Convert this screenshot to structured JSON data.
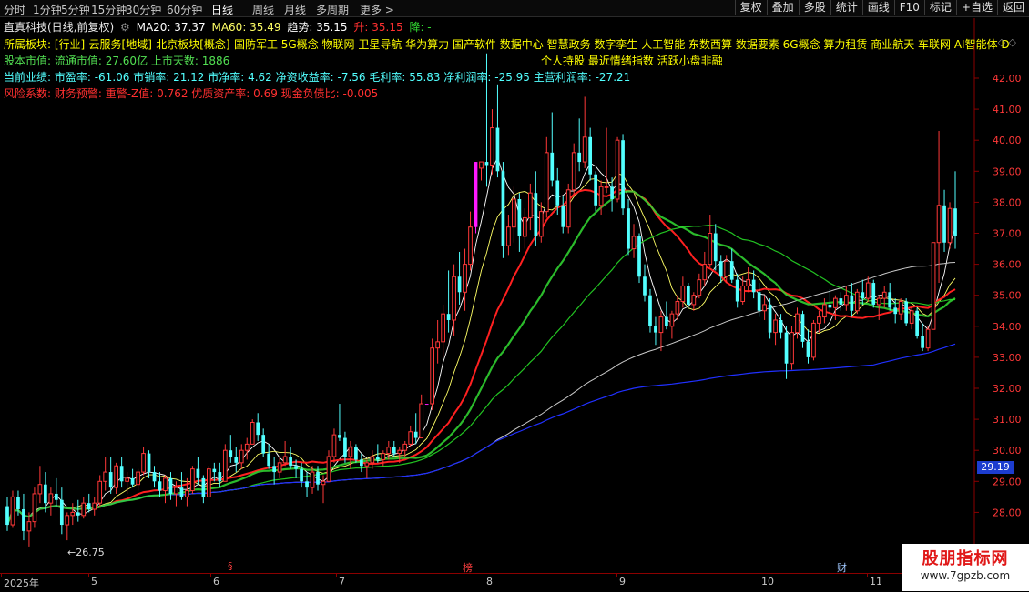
{
  "toolbar": {
    "periods": [
      "分时",
      "1分钟",
      "5分钟",
      "15分钟",
      "30分钟",
      "60分钟",
      "日线",
      "周线",
      "月线",
      "多周期",
      "更多 >"
    ],
    "active_period": "日线",
    "right_buttons": [
      "复权",
      "叠加",
      "多股",
      "统计",
      "画线",
      "F10",
      "标记",
      "+自选",
      "返回"
    ]
  },
  "info": {
    "stock": "直真科技(日线,前复权)",
    "ma20": "MA20: 37.37",
    "ma60": "MA60: 35.49",
    "trend": "趋势: 35.15",
    "up": "升: 35.15",
    "down": "降: -"
  },
  "panels": {
    "sectors": "所属板块: [行业]-云服务[地域]-北京板块[概念]-国防军工 5G概念 物联网 卫星导航 华为算力 国产软件 数据中心 智慧政务 数字孪生 人工智能 东数西算 数据要素 6G概念 算力租赁 商业航天 车联网 AI智能体 D",
    "sectors_line2": "个人持股 最近情绪指数 活跃小盘非融",
    "capital": "股本市值: 流通市值: 27.60亿 上市天数: 1886",
    "performance": "当前业绩: 市盈率: -61.06 市销率: 21.12 市净率: 4.62 净资收益率: -7.56 毛利率: 55.83 净利润率: -25.95 主营利润率: -27.21",
    "risk": "风险系数: 财务预警: 重警-Z值: 0.762 优质资产率: 0.69 现金负债比: -0.005"
  },
  "colors": {
    "up": "#ff3838",
    "down": "#52ffff",
    "limit_up": "#ff1aff",
    "ma_short": "#ffffff",
    "ma_yellow": "#ffff66",
    "ma_red": "#ff2020",
    "ma_green": "#22c322",
    "ma_gray": "#c8c8c8",
    "ma_blue": "#2030ff",
    "trend_green": "#32dc32"
  },
  "price_tag": "29.19",
  "low_label": "26.75",
  "watermark": {
    "title": "股朋指标网",
    "url": "www.7gpzb.com"
  },
  "x_axis_labels": [
    "2025年",
    "5",
    "6",
    "7",
    "8",
    "9",
    "10",
    "11"
  ],
  "markers": [
    {
      "text": "§",
      "color": "#ff4040"
    },
    {
      "text": "榜",
      "color": "#ff4040"
    },
    {
      "text": "财",
      "color": "#a0c8ff"
    }
  ],
  "chart_data": {
    "type": "candlestick",
    "title": "直真科技(日线,前复权)",
    "y_ticks": [
      28.0,
      29.0,
      30.0,
      31.0,
      32.0,
      33.0,
      34.0,
      35.0,
      36.0,
      37.0,
      38.0,
      39.0,
      40.0,
      41.0,
      42.0
    ],
    "ylim": [
      26.5,
      42.8
    ],
    "x_months": [
      "2025年",
      "5",
      "6",
      "7",
      "8",
      "9",
      "10",
      "11"
    ],
    "candles": [
      [
        28.2,
        28.5,
        27.4,
        27.6
      ],
      [
        27.6,
        28.7,
        27.5,
        28.5
      ],
      [
        28.5,
        28.7,
        27.9,
        28.1
      ],
      [
        28.1,
        28.6,
        27.1,
        27.4
      ],
      [
        27.4,
        28.0,
        26.9,
        27.7
      ],
      [
        27.7,
        28.8,
        27.5,
        28.6
      ],
      [
        28.6,
        29.5,
        28.3,
        28.9
      ],
      [
        28.9,
        29.3,
        28.0,
        28.3
      ],
      [
        28.3,
        28.8,
        27.9,
        28.6
      ],
      [
        28.6,
        29.1,
        28.2,
        28.4
      ],
      [
        28.4,
        28.8,
        27.3,
        27.6
      ],
      [
        27.6,
        28.0,
        27.1,
        27.9
      ],
      [
        27.9,
        28.3,
        27.6,
        28.0
      ],
      [
        28.0,
        28.4,
        27.7,
        27.9
      ],
      [
        27.9,
        28.5,
        27.8,
        28.3
      ],
      [
        28.3,
        28.6,
        28.0,
        28.1
      ],
      [
        28.1,
        28.5,
        27.9,
        28.3
      ],
      [
        28.3,
        29.2,
        28.2,
        29.0
      ],
      [
        29.0,
        29.8,
        28.7,
        29.3
      ],
      [
        29.3,
        29.8,
        28.6,
        28.8
      ],
      [
        28.8,
        29.6,
        28.6,
        29.5
      ],
      [
        29.5,
        29.8,
        28.8,
        29.0
      ],
      [
        29.0,
        29.3,
        28.6,
        29.1
      ],
      [
        29.1,
        29.4,
        28.8,
        28.9
      ],
      [
        28.9,
        29.4,
        28.7,
        29.3
      ],
      [
        29.3,
        30.1,
        29.2,
        29.9
      ],
      [
        29.9,
        30.0,
        29.1,
        29.3
      ],
      [
        29.3,
        29.5,
        28.8,
        29.0
      ],
      [
        29.0,
        29.3,
        28.5,
        28.7
      ],
      [
        28.7,
        29.2,
        28.3,
        29.1
      ],
      [
        29.1,
        29.3,
        28.4,
        28.6
      ],
      [
        28.6,
        29.0,
        28.2,
        28.8
      ],
      [
        28.8,
        29.3,
        28.4,
        28.5
      ],
      [
        28.5,
        29.1,
        28.2,
        28.7
      ],
      [
        28.7,
        29.5,
        28.6,
        29.4
      ],
      [
        29.4,
        29.8,
        28.9,
        29.1
      ],
      [
        29.1,
        29.2,
        28.3,
        28.5
      ],
      [
        28.5,
        29.5,
        28.5,
        29.4
      ],
      [
        29.4,
        29.6,
        29.0,
        29.3
      ],
      [
        29.3,
        29.6,
        28.8,
        29.0
      ],
      [
        29.0,
        30.2,
        29.0,
        30.0
      ],
      [
        30.0,
        30.5,
        29.6,
        29.8
      ],
      [
        29.8,
        30.1,
        29.3,
        29.6
      ],
      [
        29.6,
        30.2,
        29.4,
        30.0
      ],
      [
        30.0,
        30.4,
        29.7,
        30.2
      ],
      [
        30.2,
        31.0,
        30.2,
        30.9
      ],
      [
        30.9,
        31.2,
        30.3,
        30.5
      ],
      [
        30.5,
        30.7,
        29.8,
        29.9
      ],
      [
        29.9,
        30.2,
        29.4,
        29.5
      ],
      [
        29.5,
        29.8,
        28.9,
        29.3
      ],
      [
        29.3,
        29.8,
        29.1,
        29.6
      ],
      [
        29.6,
        30.3,
        29.5,
        29.8
      ],
      [
        29.8,
        30.1,
        29.4,
        29.5
      ],
      [
        29.5,
        29.7,
        29.1,
        29.4
      ],
      [
        29.4,
        29.6,
        28.8,
        29.0
      ],
      [
        29.0,
        29.3,
        28.5,
        28.8
      ],
      [
        28.8,
        29.5,
        28.6,
        29.3
      ],
      [
        29.3,
        29.5,
        28.7,
        28.9
      ],
      [
        28.9,
        29.2,
        28.3,
        29.0
      ],
      [
        29.0,
        30.0,
        29.0,
        29.8
      ],
      [
        29.8,
        30.7,
        29.6,
        30.5
      ],
      [
        30.5,
        31.5,
        30.3,
        30.4
      ],
      [
        30.4,
        30.6,
        29.6,
        29.8
      ],
      [
        29.8,
        30.3,
        29.4,
        30.1
      ],
      [
        30.1,
        30.2,
        29.6,
        29.7
      ],
      [
        29.7,
        29.9,
        29.3,
        29.5
      ],
      [
        29.5,
        29.7,
        29.1,
        29.6
      ],
      [
        29.6,
        30.0,
        29.4,
        29.8
      ],
      [
        29.8,
        30.2,
        29.6,
        29.7
      ],
      [
        29.7,
        30.0,
        29.5,
        29.9
      ],
      [
        29.9,
        30.3,
        29.7,
        30.1
      ],
      [
        30.1,
        30.3,
        29.8,
        29.9
      ],
      [
        29.9,
        30.1,
        29.6,
        30.0
      ],
      [
        30.0,
        30.3,
        29.8,
        30.2
      ],
      [
        30.2,
        30.8,
        30.1,
        30.6
      ],
      [
        30.6,
        31.2,
        30.2,
        30.4
      ],
      [
        30.4,
        31.8,
        30.4,
        31.5
      ],
      [
        31.5,
        31.5,
        31.5,
        31.5
      ],
      [
        31.5,
        33.6,
        31.3,
        33.3
      ],
      [
        33.3,
        34.2,
        32.8,
        33.5
      ],
      [
        33.5,
        34.7,
        33.0,
        34.4
      ],
      [
        34.4,
        35.8,
        33.8,
        34.2
      ],
      [
        34.2,
        36.0,
        33.7,
        35.6
      ],
      [
        35.6,
        36.4,
        34.7,
        35.1
      ],
      [
        35.1,
        36.5,
        34.5,
        36.0
      ],
      [
        36.0,
        37.7,
        35.8,
        37.2
      ],
      [
        37.2,
        39.3,
        37.0,
        39.3
      ],
      [
        39.1,
        39.3,
        38.7,
        39.3
      ],
      [
        39.3,
        42.8,
        38.5,
        39.2
      ],
      [
        39.2,
        41.0,
        38.9,
        40.4
      ],
      [
        40.4,
        41.8,
        38.8,
        39.0
      ],
      [
        39.0,
        39.3,
        36.2,
        36.6
      ],
      [
        36.6,
        37.6,
        36.3,
        37.2
      ],
      [
        37.2,
        38.5,
        36.7,
        38.1
      ],
      [
        38.1,
        38.3,
        36.4,
        36.9
      ],
      [
        36.9,
        37.8,
        36.5,
        37.5
      ],
      [
        37.5,
        38.6,
        37.1,
        38.3
      ],
      [
        38.3,
        39.0,
        36.6,
        36.9
      ],
      [
        36.9,
        38.0,
        36.7,
        37.7
      ],
      [
        37.7,
        40.1,
        37.5,
        39.6
      ],
      [
        39.6,
        40.9,
        38.5,
        38.7
      ],
      [
        38.7,
        39.1,
        37.6,
        37.9
      ],
      [
        37.9,
        38.2,
        37.0,
        37.2
      ],
      [
        37.2,
        38.6,
        37.0,
        38.4
      ],
      [
        38.4,
        39.9,
        38.2,
        39.6
      ],
      [
        39.6,
        40.7,
        39.0,
        39.3
      ],
      [
        39.3,
        41.4,
        39.1,
        40.1
      ],
      [
        40.1,
        40.4,
        38.7,
        38.9
      ],
      [
        38.9,
        39.0,
        37.7,
        37.9
      ],
      [
        37.9,
        38.7,
        37.6,
        38.5
      ],
      [
        38.5,
        40.4,
        38.3,
        38.5
      ],
      [
        38.5,
        38.8,
        37.7,
        38.1
      ],
      [
        38.1,
        40.1,
        38.0,
        40.0
      ],
      [
        40.0,
        40.2,
        37.6,
        37.8
      ],
      [
        37.8,
        38.1,
        36.3,
        36.5
      ],
      [
        36.5,
        37.3,
        36.2,
        36.9
      ],
      [
        36.9,
        37.0,
        35.4,
        35.6
      ],
      [
        35.6,
        36.0,
        34.8,
        35.0
      ],
      [
        35.0,
        35.2,
        33.8,
        34.0
      ],
      [
        34.0,
        34.3,
        33.4,
        33.8
      ],
      [
        33.8,
        34.5,
        33.2,
        34.3
      ],
      [
        34.3,
        34.8,
        33.9,
        34.0
      ],
      [
        34.0,
        34.5,
        33.6,
        34.4
      ],
      [
        34.4,
        35.0,
        34.2,
        34.8
      ],
      [
        34.8,
        35.6,
        34.6,
        35.3
      ],
      [
        35.3,
        35.4,
        34.6,
        34.7
      ],
      [
        34.7,
        35.1,
        34.5,
        35.0
      ],
      [
        35.0,
        35.7,
        34.9,
        35.5
      ],
      [
        35.5,
        36.4,
        35.3,
        36.0
      ],
      [
        36.0,
        37.6,
        35.9,
        37.0
      ],
      [
        37.0,
        37.3,
        35.8,
        36.1
      ],
      [
        36.1,
        36.3,
        35.4,
        35.6
      ],
      [
        35.6,
        36.3,
        35.4,
        36.1
      ],
      [
        36.1,
        36.5,
        35.4,
        35.5
      ],
      [
        35.5,
        35.7,
        34.6,
        34.8
      ],
      [
        34.8,
        35.6,
        34.7,
        35.3
      ],
      [
        35.3,
        35.9,
        35.1,
        35.5
      ],
      [
        35.5,
        35.8,
        34.9,
        35.1
      ],
      [
        35.1,
        35.4,
        34.3,
        34.5
      ],
      [
        34.5,
        35.0,
        34.2,
        34.7
      ],
      [
        34.7,
        34.9,
        33.6,
        33.8
      ],
      [
        33.8,
        34.4,
        33.4,
        34.2
      ],
      [
        34.2,
        34.4,
        33.6,
        33.8
      ],
      [
        33.8,
        34.0,
        32.3,
        32.8
      ],
      [
        32.8,
        34.0,
        32.6,
        33.8
      ],
      [
        33.8,
        34.6,
        33.6,
        34.4
      ],
      [
        34.4,
        34.5,
        33.3,
        33.5
      ],
      [
        33.5,
        33.9,
        32.8,
        33.0
      ],
      [
        33.0,
        34.2,
        32.9,
        34.1
      ],
      [
        34.1,
        34.5,
        33.8,
        34.3
      ],
      [
        34.3,
        34.9,
        34.1,
        34.7
      ],
      [
        34.7,
        35.2,
        34.4,
        34.6
      ],
      [
        34.6,
        35.0,
        34.2,
        34.9
      ],
      [
        34.9,
        35.1,
        34.5,
        34.7
      ],
      [
        34.7,
        35.3,
        34.5,
        35.0
      ],
      [
        35.0,
        35.4,
        34.3,
        34.5
      ],
      [
        34.5,
        35.2,
        34.4,
        35.1
      ],
      [
        35.1,
        35.5,
        34.7,
        34.9
      ],
      [
        34.9,
        35.6,
        34.8,
        35.4
      ],
      [
        35.4,
        35.5,
        34.6,
        34.7
      ],
      [
        34.7,
        35.0,
        34.2,
        34.9
      ],
      [
        34.9,
        35.3,
        34.6,
        35.1
      ],
      [
        35.1,
        35.4,
        34.5,
        34.6
      ],
      [
        34.6,
        34.9,
        34.1,
        34.4
      ],
      [
        34.4,
        34.9,
        34.2,
        34.8
      ],
      [
        34.8,
        34.9,
        34.0,
        34.1
      ],
      [
        34.1,
        34.6,
        33.9,
        34.5
      ],
      [
        34.5,
        34.6,
        33.6,
        33.7
      ],
      [
        33.7,
        34.1,
        33.2,
        33.3
      ],
      [
        33.3,
        34.0,
        33.2,
        33.9
      ],
      [
        33.9,
        36.7,
        33.9,
        36.7
      ],
      [
        36.7,
        40.3,
        35.4,
        37.9
      ],
      [
        37.9,
        38.4,
        36.4,
        36.7
      ],
      [
        36.7,
        38.0,
        36.5,
        37.8
      ],
      [
        37.8,
        39.0,
        36.5,
        36.9
      ]
    ],
    "limit_up_days": [
      77,
      86,
      175
    ],
    "ma_values": [
      {
        "name": "MA20",
        "value": 37.37
      },
      {
        "name": "MA60",
        "value": 35.49
      }
    ],
    "trend_value": 35.15,
    "last_price_tag": 29.19,
    "low_marker": 26.75
  }
}
